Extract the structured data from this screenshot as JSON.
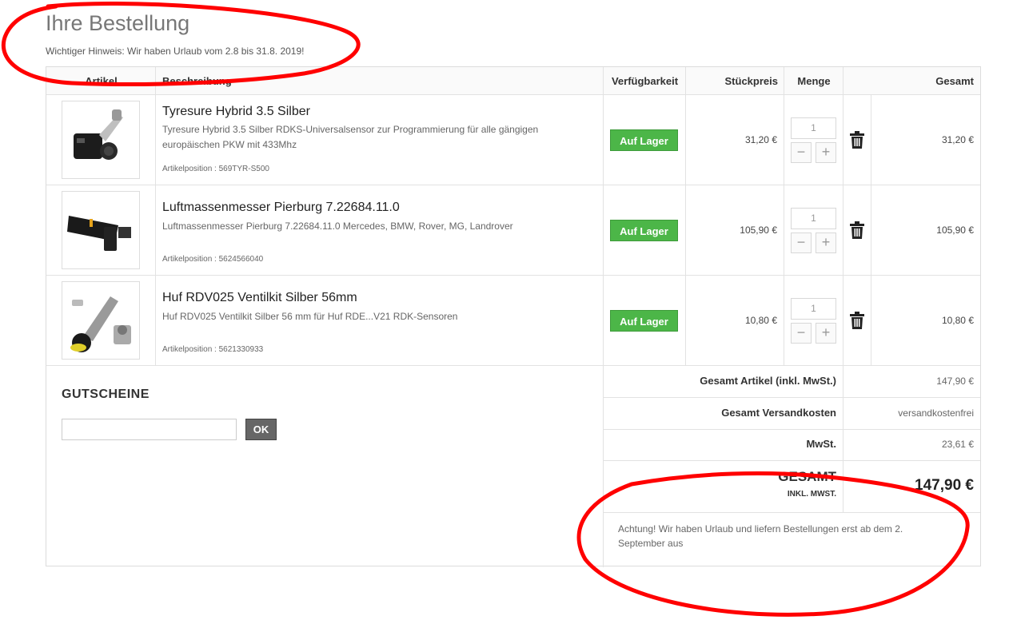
{
  "page": {
    "title": "Ihre Bestellung",
    "notice": "Wichtiger Hinweis: Wir haben Urlaub vom 2.8 bis 31.8. 2019!"
  },
  "table": {
    "headers": {
      "article": "Artikel",
      "description": "Beschreibung",
      "availability": "Verfügbarkeit",
      "unit_price": "Stückpreis",
      "quantity": "Menge",
      "total": "Gesamt"
    },
    "rows": [
      {
        "title": "Tyresure Hybrid 3.5 Silber",
        "description": "Tyresure Hybrid 3.5 Silber RDKS-Universalsensor zur Programmierung für alle gängigen europäischen PKW mit 433Mhz",
        "position": "Artikelposition : 569TYR-S500",
        "availability": "Auf Lager",
        "unit_price": "31,20 €",
        "quantity": "1",
        "total": "31,20 €",
        "image_icon": "tpms-sensor-image"
      },
      {
        "title": "Luftmassenmesser Pierburg 7.22684.11.0",
        "description": "Luftmassenmesser Pierburg 7.22684.11.0 Mercedes, BMW, Rover, MG, Landrover",
        "position": "Artikelposition : 5624566040",
        "availability": "Auf Lager",
        "unit_price": "105,90 €",
        "quantity": "1",
        "total": "105,90 €",
        "image_icon": "air-mass-meter-image"
      },
      {
        "title": "Huf RDV025 Ventilkit Silber 56mm",
        "description": "Huf RDV025 Ventilkit Silber 56 mm für Huf RDE...V21 RDK-Sensoren",
        "position": "Artikelposition : 5621330933",
        "availability": "Auf Lager",
        "unit_price": "10,80 €",
        "quantity": "1",
        "total": "10,80 €",
        "image_icon": "valve-kit-image"
      }
    ],
    "qty_minus": "−",
    "qty_plus": "+"
  },
  "voucher": {
    "title": "GUTSCHEINE",
    "input_value": "",
    "button": "OK"
  },
  "summary": {
    "items_label": "Gesamt Artikel (inkl. MwSt.)",
    "items_value": "147,90 €",
    "shipping_label": "Gesamt Versandkosten",
    "shipping_value": "versandkostenfrei",
    "vat_label": "MwSt.",
    "vat_value": "23,61 €",
    "total_label": "GESAMT",
    "total_sub": "INKL. MWST.",
    "total_value": "147,90 €",
    "holiday_note": "Achtung! Wir haben Urlaub und liefern Bestellungen erst ab dem 2. September aus"
  },
  "colors": {
    "in_stock": "#4cb648",
    "annotation": "#ff0000"
  }
}
